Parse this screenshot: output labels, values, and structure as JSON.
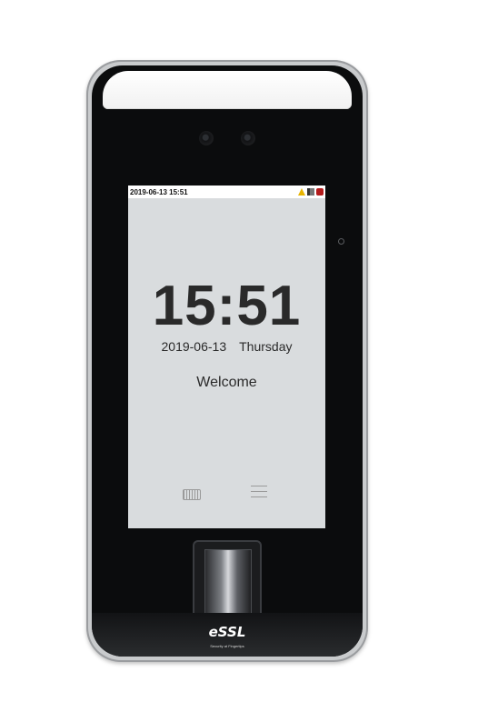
{
  "status_bar": {
    "datetime": "2019-06-13 15:51",
    "icons": [
      "warning-icon",
      "network-icon",
      "card-icon"
    ]
  },
  "screen": {
    "time": "15:51",
    "date": "2019-06-13",
    "weekday": "Thursday",
    "welcome": "Welcome"
  },
  "controls": {
    "icons": [
      "keyboard-icon",
      "menu-icon"
    ]
  },
  "brand": {
    "logo": "eSSL",
    "tagline": "Security at Fingertips"
  }
}
